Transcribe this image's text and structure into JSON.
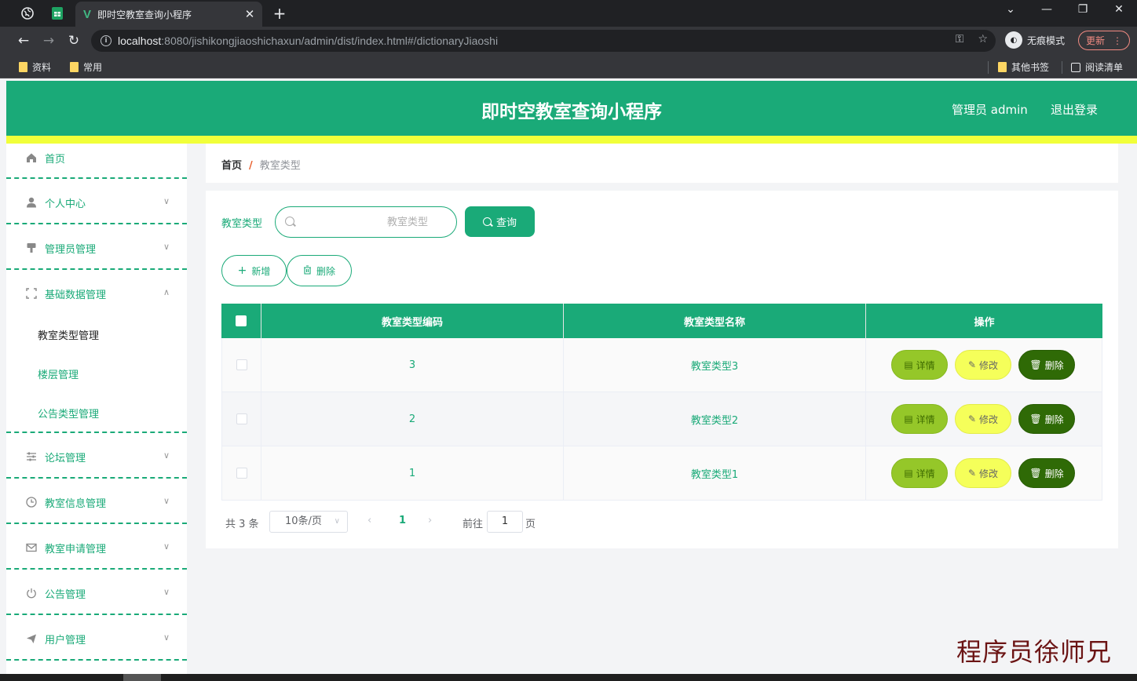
{
  "browser": {
    "active_tab_title": "即时空教室查询小程序",
    "url_host": "localhost",
    "url_rest": ":8080/jishikongjiaoshichaxun/admin/dist/index.html#/dictionaryJiaoshi",
    "incognito_label": "无痕模式",
    "update_label": "更新",
    "bookmarks": [
      "资料",
      "常用"
    ],
    "other_bookmarks": "其他书签",
    "reading_list": "阅读清单"
  },
  "header": {
    "title": "即时空教室查询小程序",
    "user": "管理员 admin",
    "logout": "退出登录"
  },
  "sidebar": {
    "home": "首页",
    "items": [
      "个人中心",
      "管理员管理",
      "基础数据管理",
      "论坛管理",
      "教室信息管理",
      "教室申请管理",
      "公告管理",
      "用户管理"
    ],
    "submenu": [
      "教室类型管理",
      "楼层管理",
      "公告类型管理"
    ]
  },
  "breadcrumb": {
    "home": "首页",
    "separator": "/",
    "current": "教室类型"
  },
  "search": {
    "label": "教室类型",
    "placeholder": "教室类型",
    "button": "查询"
  },
  "actions": {
    "add": "新增",
    "delete": "删除"
  },
  "table": {
    "columns": [
      "教室类型编码",
      "教室类型名称",
      "操作"
    ],
    "rows": [
      {
        "code": "3",
        "name": "教室类型3"
      },
      {
        "code": "2",
        "name": "教室类型2"
      },
      {
        "code": "1",
        "name": "教室类型1"
      }
    ],
    "row_actions": {
      "detail": "详情",
      "edit": "修改",
      "delete": "删除"
    }
  },
  "pagination": {
    "total": "共 3 条",
    "page_size": "10条/页",
    "current_page": "1",
    "goto_label": "前往",
    "goto_value": "1",
    "page_unit": "页"
  },
  "watermark": "程序员徐师兄",
  "colors": {
    "primary": "#1aaa78",
    "accent_strip": "#f1ff3a",
    "detail_button": "#95c729",
    "edit_button": "#f5ff5a",
    "delete_button": "#2f6a06"
  }
}
